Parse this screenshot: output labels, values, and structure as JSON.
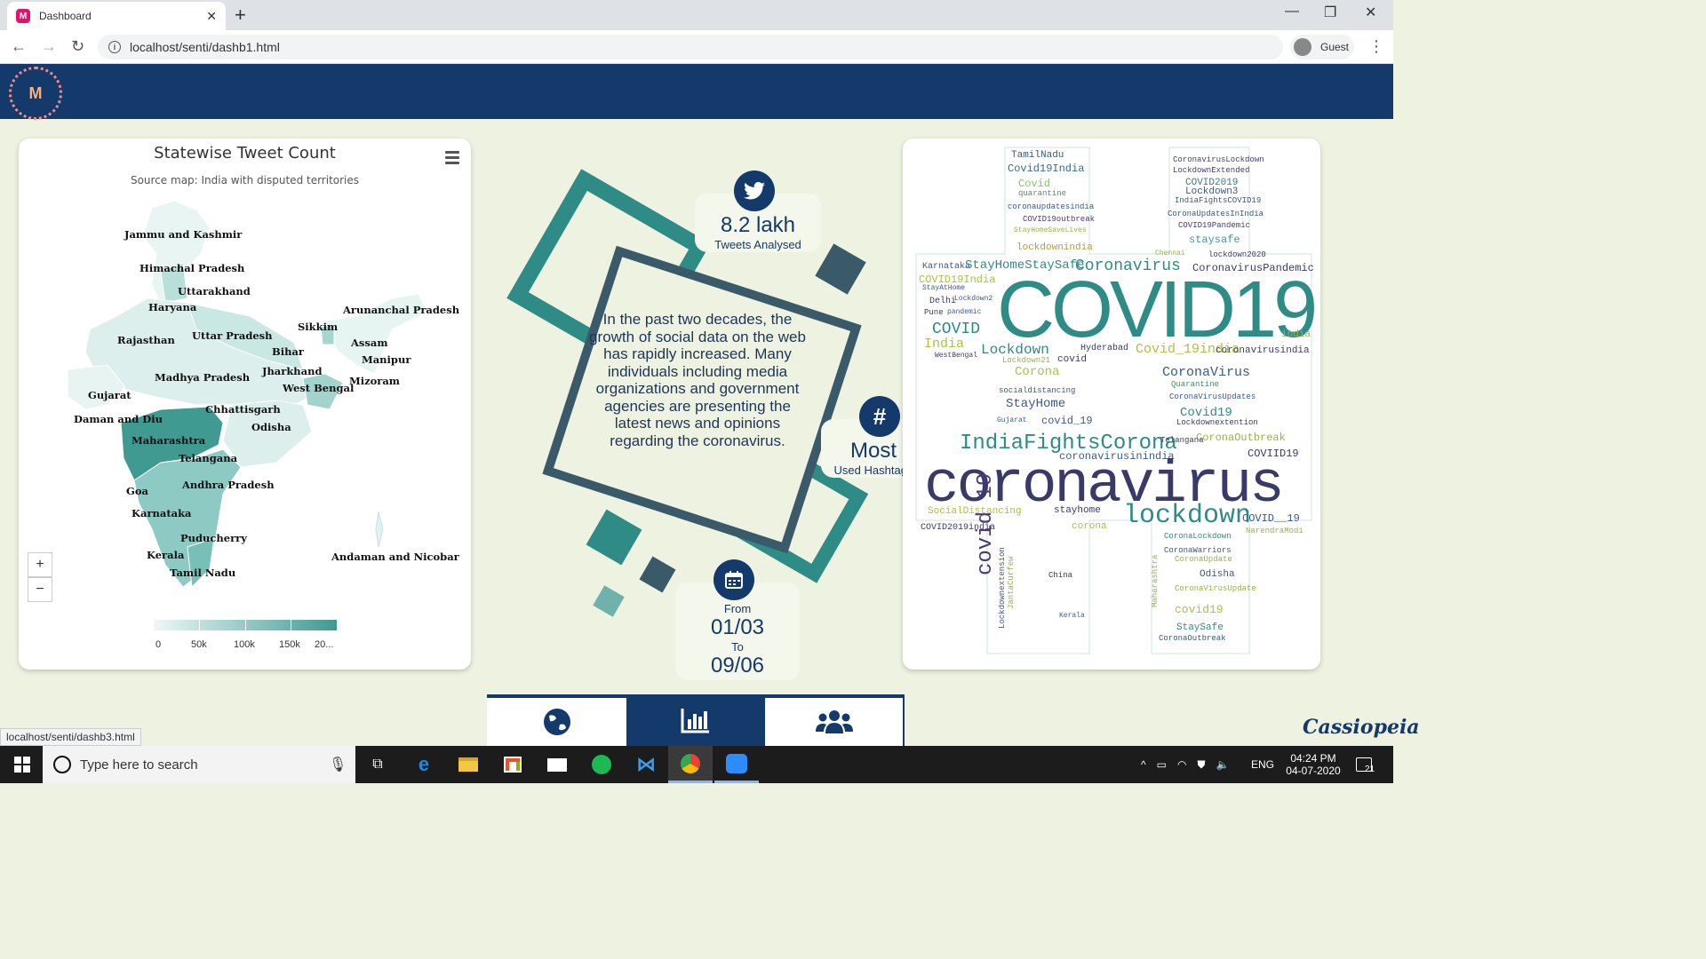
{
  "browser": {
    "tab_title": "Dashboard",
    "url": "localhost/senti/dashb1.html",
    "profile": "Guest",
    "status_url": "localhost/senti/dashb3.html"
  },
  "map": {
    "title": "Statewise Tweet Count",
    "subtitle": "Source map: India with disputed territories",
    "zoom_in": "+",
    "zoom_out": "−",
    "legend": [
      "0",
      "50k",
      "100k",
      "150k",
      "20..."
    ],
    "states": [
      "Jammu and Kashmir",
      "Himachal Pradesh",
      "Uttarakhand",
      "Haryana",
      "Arunanchal Pradesh",
      "Sikkim",
      "Rajasthan",
      "Uttar Pradesh",
      "Assam",
      "Bihar",
      "Manipur",
      "Jharkhand",
      "Madhya Pradesh",
      "Mizoram",
      "West Bengal",
      "Gujarat",
      "Chhattisgarh",
      "Odisha",
      "Daman and Diu",
      "Maharashtra",
      "Telangana",
      "Andhra Pradesh",
      "Goa",
      "Karnataka",
      "Puducherry",
      "Kerala",
      "Andaman and Nicobar",
      "Tamil Nadu"
    ]
  },
  "center": {
    "paragraph": "In the past two decades, the growth of social data on the web has rapidly increased. Many individuals including media organizations and government agencies are presenting the latest news and opinions regarding the coronavirus.",
    "tweets_value": "8.2 lakh",
    "tweets_label": "Tweets Analysed",
    "hashtag_value": "Most",
    "hashtag_label": "Used Hashtags",
    "hashtag_symbol": "#",
    "from_label": "From",
    "from_date": "01/03",
    "to_label": "To",
    "to_date": "09/06"
  },
  "wordcloud": [
    {
      "t": "TamilNadu"
    },
    {
      "t": "Covid19India"
    },
    {
      "t": "Covid"
    },
    {
      "t": "quarantine"
    },
    {
      "t": "coronaupdatesindia"
    },
    {
      "t": "COVID19outbreak"
    },
    {
      "t": "StayHomeSaveLives"
    },
    {
      "t": "lockdownindia"
    },
    {
      "t": "CoronavirusLockdown"
    },
    {
      "t": "LockdownExtended"
    },
    {
      "t": "COVID2019"
    },
    {
      "t": "Lockdown3"
    },
    {
      "t": "IndiaFightsCOVID19"
    },
    {
      "t": "CoronaUpdatesInIndia"
    },
    {
      "t": "COVID19Pandemic"
    },
    {
      "t": "staysafe"
    },
    {
      "t": "lockdown2020"
    },
    {
      "t": "Karnataka"
    },
    {
      "t": "StayHomeStaySafe"
    },
    {
      "t": "Coronavirus"
    },
    {
      "t": "CoronavirusPandemic"
    },
    {
      "t": "COVID19India"
    },
    {
      "t": "StayAtHome"
    },
    {
      "t": "COVID19"
    },
    {
      "t": "Delhi"
    },
    {
      "t": "Pune"
    },
    {
      "t": "pandemic"
    },
    {
      "t": "Lockdown2"
    },
    {
      "t": "COVID"
    },
    {
      "t": "India"
    },
    {
      "t": "WestBengal"
    },
    {
      "t": "Lockdown"
    },
    {
      "t": "covid"
    },
    {
      "t": "Lockdown21"
    },
    {
      "t": "Hyderabad"
    },
    {
      "t": "Covid_19india"
    },
    {
      "t": "coronavirusindia"
    },
    {
      "t": "india"
    },
    {
      "t": "Corona"
    },
    {
      "t": "CoronaVirus"
    },
    {
      "t": "Quarantine"
    },
    {
      "t": "socialdistancing"
    },
    {
      "t": "CoronaVirusUpdates"
    },
    {
      "t": "StayHome"
    },
    {
      "t": "Covid19"
    },
    {
      "t": "Gujarat"
    },
    {
      "t": "covid_19"
    },
    {
      "t": "Lockdownextention"
    },
    {
      "t": "CoronaOutbreak"
    },
    {
      "t": "IndiaFightsCorona"
    },
    {
      "t": "Telangana"
    },
    {
      "t": "coronavirusinindia"
    },
    {
      "t": "COVIID19"
    },
    {
      "t": "coronavirus"
    },
    {
      "t": "SocialDistancing"
    },
    {
      "t": "stayhome"
    },
    {
      "t": "lockdown"
    },
    {
      "t": "COVID__19"
    },
    {
      "t": "COVID2019india"
    },
    {
      "t": "corona"
    },
    {
      "t": "NarendraModi"
    },
    {
      "t": "CoronaLockdown"
    },
    {
      "t": "covid 19"
    },
    {
      "t": "CoronaWarriors"
    },
    {
      "t": "CoronaUpdate"
    },
    {
      "t": "China"
    },
    {
      "t": "Odisha"
    },
    {
      "t": "CoronaVirusUpdate"
    },
    {
      "t": "covid19"
    },
    {
      "t": "StaySafe"
    },
    {
      "t": "CoronaOutbreak"
    },
    {
      "t": "Maharashtra"
    },
    {
      "t": "JantaCurfew"
    },
    {
      "t": "Lockdownextension"
    },
    {
      "t": "Kerala"
    },
    {
      "t": "Chennai"
    }
  ],
  "bottom_nav": [
    {
      "name": "globe-icon",
      "active": false
    },
    {
      "name": "bar-chart-icon",
      "active": true
    },
    {
      "name": "users-icon",
      "active": false
    }
  ],
  "brand": "Cassiopeia",
  "taskbar": {
    "search_placeholder": "Type here to search",
    "lang": "ENG",
    "time": "04:24 PM",
    "date": "04-07-2020",
    "notif_count": "21"
  },
  "colors": {
    "header": "#14396b",
    "teal": "#2e8b86",
    "background": "#eef3e1"
  }
}
